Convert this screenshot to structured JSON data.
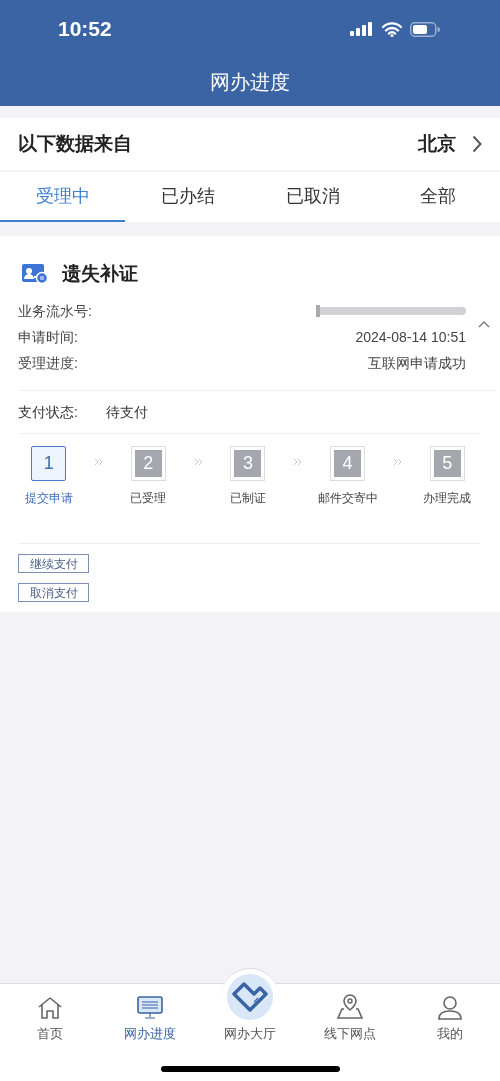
{
  "status_bar": {
    "time": "10:52"
  },
  "header": {
    "title": "网办进度"
  },
  "source": {
    "label": "以下数据来自",
    "city": "北京"
  },
  "tabs": [
    {
      "label": "受理中",
      "selected": true
    },
    {
      "label": "已办结",
      "selected": false
    },
    {
      "label": "已取消",
      "selected": false
    },
    {
      "label": "全部",
      "selected": false
    }
  ],
  "card": {
    "title": "遗失补证",
    "fields": [
      {
        "label": "业务流水号:",
        "kind": "redacted"
      },
      {
        "label": "申请时间:",
        "value": "2024-08-14 10:51",
        "kind": "text"
      },
      {
        "label": "受理进度:",
        "value": "互联网申请成功",
        "kind": "text"
      }
    ],
    "payment": {
      "label": "支付状态:",
      "value": "待支付"
    },
    "steps": [
      {
        "number": "1",
        "label": "提交申请",
        "selected": true
      },
      {
        "number": "2",
        "label": "已受理",
        "selected": false
      },
      {
        "number": "3",
        "label": "已制证",
        "selected": false
      },
      {
        "number": "4",
        "label": "邮件交寄中",
        "selected": false
      },
      {
        "number": "5",
        "label": "办理完成",
        "selected": false
      }
    ],
    "buttons": [
      "继续支付",
      "取消支付"
    ]
  },
  "nav": [
    {
      "label": "首页",
      "selected": false
    },
    {
      "label": "网办进度",
      "selected": true
    },
    {
      "label": "网办大厅",
      "selected": false
    },
    {
      "label": "线下网点",
      "selected": false
    },
    {
      "label": "我的",
      "selected": false
    }
  ]
}
